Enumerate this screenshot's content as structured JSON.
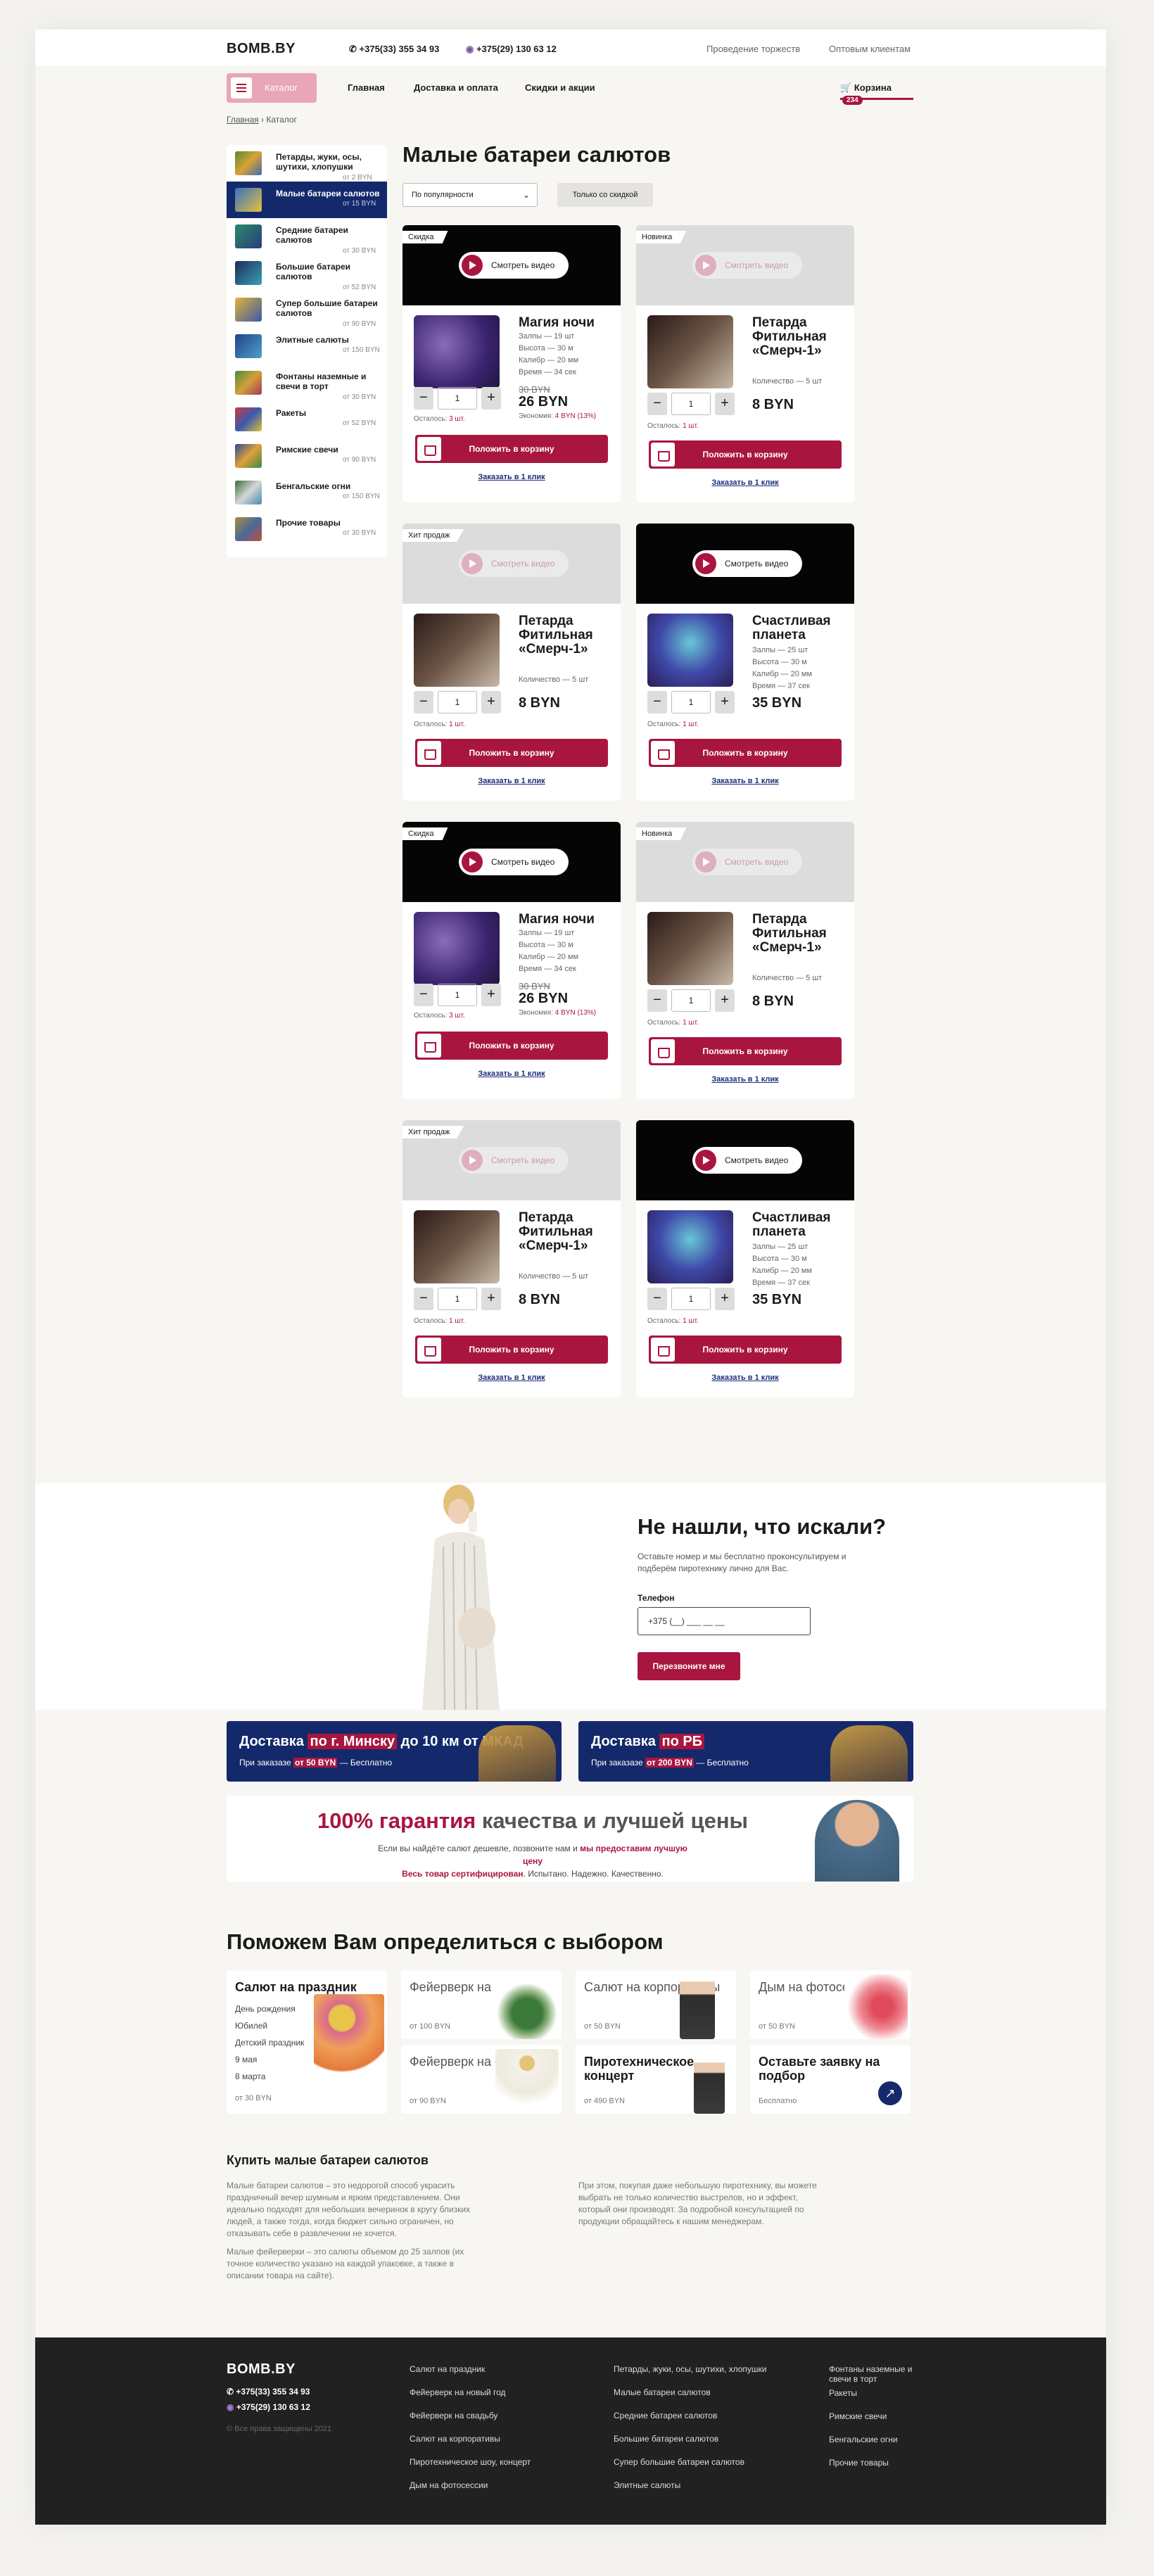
{
  "header": {
    "logo": "BOMB.BY",
    "phone1": "+375(33) 355 34 93",
    "phone2": "+375(29) 130 63 12",
    "link_events": "Проведение торжеств",
    "link_wholesale": "Оптовым клиентам"
  },
  "nav": {
    "catalog": "Каталог",
    "main": "Главная",
    "delivery": "Доставка и оплата",
    "sales": "Скидки и акции",
    "cart": "Корзина",
    "cart_count": "234"
  },
  "breadcrumbs": {
    "home": "Главная",
    "sep": "›",
    "current": "Каталог"
  },
  "sidebar": [
    {
      "label": "Петарды, жуки, осы, шутихи, хлопушки",
      "short": "Петарды, жуки, осы, шутихи, хлопушки",
      "price": "от 2 BYN"
    },
    {
      "label": "Малые батареи салютов",
      "price": "от 15 BYN"
    },
    {
      "label": "Средние батареи салютов",
      "price": "от 30 BYN"
    },
    {
      "label": "Большие батареи салютов",
      "price": "от 52 BYN"
    },
    {
      "label": "Супер большие батареи салютов",
      "price": "от 90 BYN"
    },
    {
      "label": "Элитные салюты",
      "price": "от 150 BYN"
    },
    {
      "label": "Фонтаны наземные и свечи в торт",
      "price": "от 30 BYN"
    },
    {
      "label": "Ракеты",
      "price": "от 52 BYN"
    },
    {
      "label": "Римские свечи",
      "price": "от 90 BYN"
    },
    {
      "label": "Бенгальские огни",
      "price": "от 150 BYN"
    },
    {
      "label": "Прочие товары",
      "price": "от 30 BYN"
    }
  ],
  "page_title": "Малые батареи салютов",
  "filters": {
    "sort": "По популярности",
    "discount_only": "Только со скидкой"
  },
  "cards": {
    "video_label": "Смотреть видео",
    "add_label": "Положить в корзину",
    "oneclick_label": "Заказать в 1 клик",
    "qty": "1",
    "left_label": "Осталось:",
    "save_label": "Экономия:",
    "tag_sale": "Скидка",
    "tag_new": "Новинка",
    "tag_hit": "Хит продаж",
    "magic": {
      "name": "Магия ночи",
      "s1": "Залпы — 19 шт",
      "s2": "Высота — 30 м",
      "s3": "Калибр — 20 мм",
      "s4": "Время — 34 сек",
      "old": "30 BYN",
      "price": "26 BYN",
      "save": "4 BYN (13%)",
      "left": "3 шт."
    },
    "petard": {
      "name": "Петарда Фитильная «Смерч-1»",
      "s1": "Количество — 5 шт",
      "price": "8 BYN",
      "left": "1 шт."
    },
    "planet": {
      "name": "Счастливая планета",
      "s1": "Залпы — 25 шт",
      "s2": "Высота — 30 м",
      "s3": "Калибр — 20 мм",
      "s4": "Время — 37 сек",
      "price": "35 BYN",
      "left": "1 шт."
    }
  },
  "promo": {
    "title": "Не нашли, что искали?",
    "desc": "Оставьте номер и мы бесплатно проконсультируем и подберём пиротехнику лично для Вас.",
    "phone_label": "Телефон",
    "phone_placeholder": "+375 (__) ___ __ __",
    "button": "Перезвоните мне"
  },
  "delivery": {
    "d1_a": "Доставка ",
    "d1_h": "по г. Минску",
    "d1_b": " до 10 км от МКАД",
    "d1_s_a": "При заказазе ",
    "d1_s_h": "от 50 BYN",
    "d1_s_b": " — Бесплатно",
    "d2_a": "Доставка ",
    "d2_h": "по РБ",
    "d2_s_a": "При заказазе ",
    "d2_s_h": "от 200 BYN",
    "d2_s_b": " — Бесплатно"
  },
  "guarantee": {
    "t_h": "100% гарантия",
    "t_b": " качества и лучшей цены",
    "d_a": "Если вы найдёте салют дешевле, позвоните нам и ",
    "d_h": "мы предоставим лучшую цену",
    "d_h2": "Весь товар сертифицирован",
    "d_b": ". Испытано. Надежно. Качественно."
  },
  "help": {
    "title": "Поможем Вам определиться с выбором",
    "holiday": {
      "title": "Салют на праздник",
      "items": [
        "День рождения",
        "Юбилей",
        "Детский праздник",
        "9 мая",
        "8 марта"
      ],
      "price": "от 30 BYN"
    },
    "newyear": {
      "title": "Фейерверк на новый год",
      "price": "от 100 BYN"
    },
    "corporate": {
      "title": "Салют на корпоративы",
      "price": "от 50 BYN"
    },
    "smoke": {
      "title": "Дым на фотосессии",
      "price": "от 50 BYN"
    },
    "wedding": {
      "title": "Фейерверк на свадьбу",
      "price": "от 90 BYN"
    },
    "show": {
      "title": "Пиротехническое шоу, концерт",
      "price": "от 490 BYN"
    },
    "request": {
      "title": "Оставьте заявку на подбор",
      "price": "Бесплатно"
    }
  },
  "seo": {
    "title": "Купить малые батареи салютов",
    "p1": "Малые батареи салютов – это недорогой способ украсить праздничный вечер шумным и ярким представлением. Они идеально подходят для небольших вечеринок в кругу близких людей, а также тогда, когда бюджет сильно ограничен, но отказывать себе в развлечении не хочется.",
    "p2": "Малые фейерверки – это салюты объемом до 25 залпов (их точное количество указано на каждой упаковке, а также в описании товара на сайте).",
    "p3": "При этом, покупая даже небольшую пиротехнику, вы можете выбрать не только количество выстрелов, но и эффект, который они производят. За подробной консультацией по продукции обращайтесь к нашим менеджерам."
  },
  "footer": {
    "logo": "BOMB.BY",
    "phone1": "+375(33) 355 34 93",
    "phone2": "+375(29) 130 63 12",
    "copy": "© Все права защищены 2021",
    "col1": [
      "Салют на праздник",
      "Фейерверк на новый год",
      "Фейерверк на свадьбу",
      "Салют на корпоративы",
      "Пиротехническое шоу, концерт",
      "Дым на фотосессии"
    ],
    "col2": [
      "Петарды, жуки, осы, шутихи, хлопушки",
      "Малые батареи салютов",
      "Средние батареи салютов",
      "Большие батареи салютов",
      "Супер большие батареи салютов",
      "Элитные салюты"
    ],
    "col3": [
      "Фонтаны наземные и свечи в торт",
      "Ракеты",
      "Римские свечи",
      "Бенгальские огни",
      "Прочие товары"
    ]
  },
  "colors": {
    "accent": "#a8163f",
    "navy": "#13296b"
  }
}
